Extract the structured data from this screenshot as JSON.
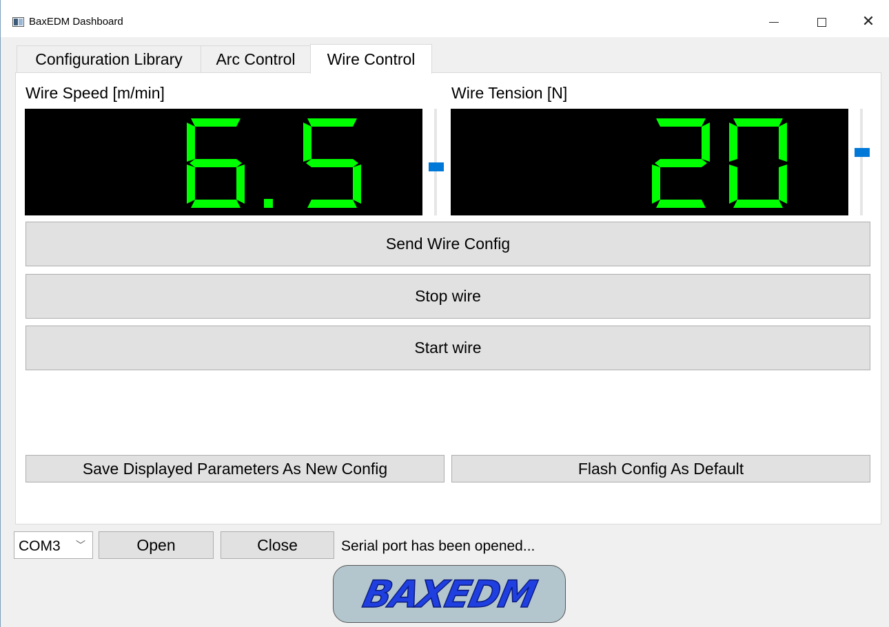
{
  "window": {
    "title": "BaxEDM Dashboard",
    "controls": [
      "minimize",
      "maximize",
      "close"
    ]
  },
  "tabs": [
    {
      "label": "Configuration Library",
      "active": false
    },
    {
      "label": "Arc Control",
      "active": false
    },
    {
      "label": "Wire Control",
      "active": true
    }
  ],
  "wire_control": {
    "speed": {
      "label": "Wire Speed [m/min]",
      "display_value": "6.5",
      "slider_icon": "slider-handle-icon"
    },
    "tension": {
      "label": "Wire Tension [N]",
      "display_value": "20",
      "slider_icon": "slider-handle-icon"
    },
    "lcd_color": "#00ff00",
    "lcd_background": "#000000",
    "accent_color": "#0078d7",
    "buttons": {
      "send": "Send Wire Config",
      "stop": "Stop wire",
      "start": "Start wire",
      "save": "Save Displayed Parameters As New Config",
      "flash": "Flash Config As Default"
    }
  },
  "serial": {
    "port": "COM3",
    "open_label": "Open",
    "close_label": "Close",
    "status": "Serial port has been opened..."
  },
  "logo": {
    "text": "BAXEDM"
  }
}
